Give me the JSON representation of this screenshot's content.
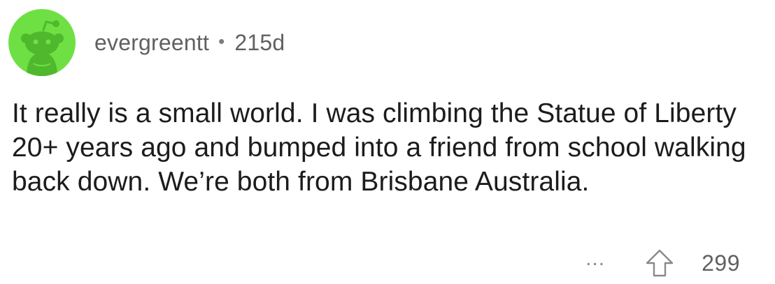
{
  "comment": {
    "username": "evergreentt",
    "separator": "•",
    "age": "215d",
    "text": "It really is a small world. I was climbing the Statue of Liberty 20+ years ago and bumped into a friend from school walking back down. We’re both from Brisbane Australia.",
    "more_label": "...",
    "score": "299",
    "avatar_color": "#6fe044",
    "avatar_icon": "snoo-avatar-icon",
    "upvote_icon": "upvote-arrow-icon"
  },
  "colors": {
    "meta_text": "#5f6163",
    "body_text": "#1c1c1c",
    "icon_gray": "#878a8c"
  }
}
